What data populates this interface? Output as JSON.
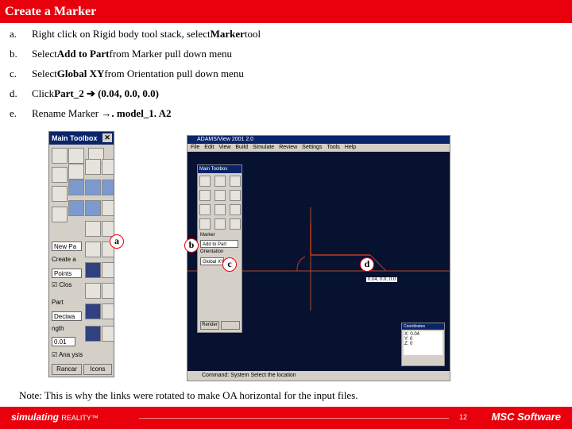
{
  "title": "Create a Marker",
  "steps": [
    {
      "letter": "a.",
      "pre": "Right click on Rigid body tool stack, select ",
      "bold": "Marker",
      "post": " tool"
    },
    {
      "letter": "b.",
      "pre": "Select ",
      "bold": "Add to Part",
      "post": " from Marker pull down menu"
    },
    {
      "letter": "c.",
      "pre": "Select ",
      "bold": "Global XY",
      "post": " from Orientation pull down menu"
    },
    {
      "letter": "d.",
      "pre": "Click ",
      "bold": "Part_2 ➔ (0.04, 0.0, 0.0)",
      "post": ""
    },
    {
      "letter": "e.",
      "pre": "Rename Marker → ",
      "bold": ". model_1. A2",
      "post": ""
    }
  ],
  "main_toolbox": {
    "title": "Main Toolbox",
    "field_1": "New Pa",
    "label_create": "Create a",
    "field_points": "Points",
    "check_label": "Clos",
    "label_part": "Part",
    "field_type": "Deciwa",
    "label_length": "ngth",
    "field_length": "0.01",
    "label_analysis": "Ana ysis",
    "btn_rename": "Rancar",
    "btn_icons": "Icons"
  },
  "adams_window": {
    "title": "ADAMS/View 2001 2.0",
    "menu": [
      "File",
      "Edit",
      "View",
      "Build",
      "Simulate",
      "Review",
      "Settings",
      "Tools",
      "Help"
    ],
    "status": "Command: System Select the location",
    "point_label": "0.04, 0.0, 0.0"
  },
  "small_toolbox": {
    "title": "Main Toolbox",
    "label_marker": "Marker",
    "field_add": "Add to Part",
    "label_orient": "Orientation",
    "field_global": "Global XY",
    "btn_render": "Render"
  },
  "coord_info": {
    "title": "Coordinates",
    "rows": [
      "X: 0.04",
      "Y: 0",
      "Z: 0"
    ]
  },
  "callouts": {
    "a": "a",
    "b": "b",
    "c": "c",
    "d": "d"
  },
  "note": "Note: This is why the links were rotated to make OA horizontal for the input files.",
  "footer": {
    "brand": "simulating",
    "brand_tail": "REALITY™",
    "page": "12",
    "company": "MSC Software"
  }
}
